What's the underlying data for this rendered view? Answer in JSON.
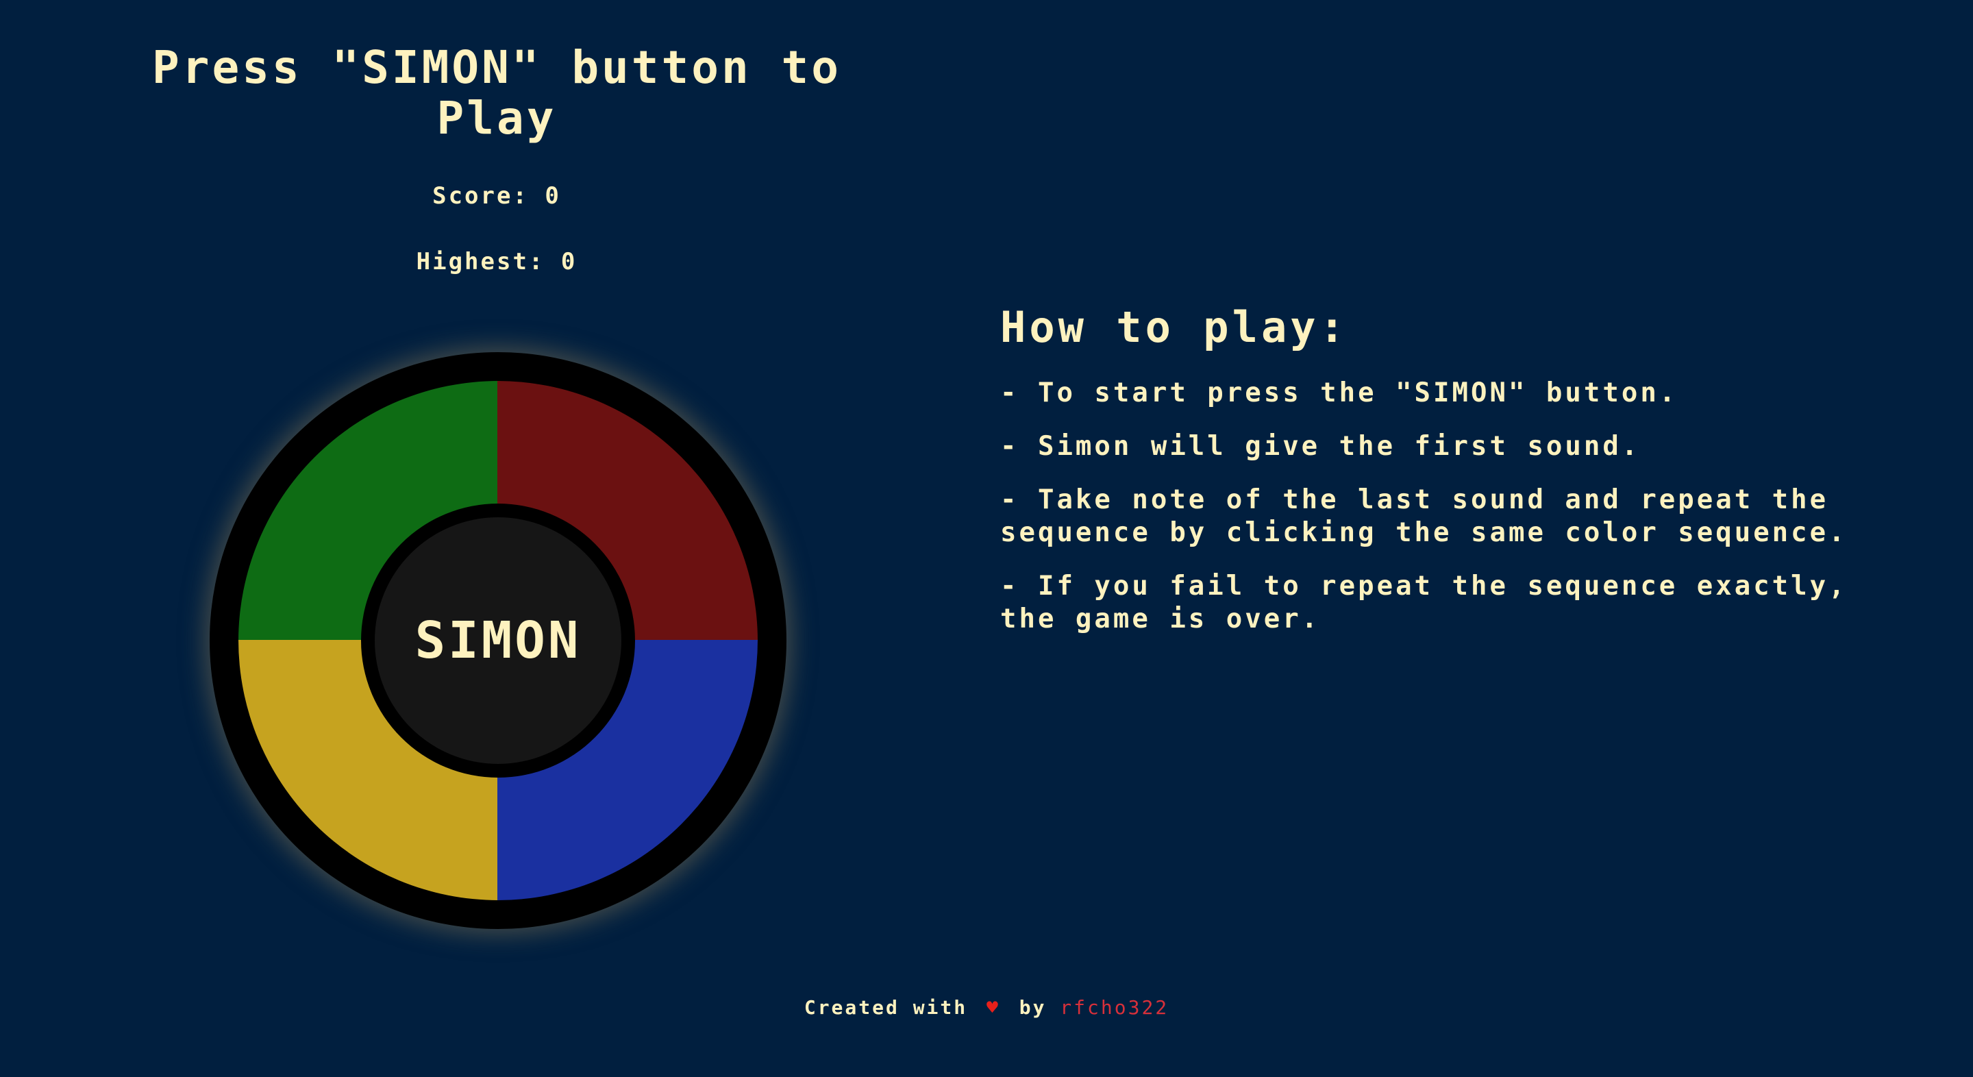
{
  "game": {
    "title": "Press \"SIMON\" button to Play",
    "score_label": "Score: 0",
    "highest_label": "Highest: 0",
    "center_button_label": "SIMON",
    "pads": [
      {
        "name": "green",
        "color": "#0e6c14"
      },
      {
        "name": "red",
        "color": "#6b1111"
      },
      {
        "name": "yellow",
        "color": "#c6a31f"
      },
      {
        "name": "blue",
        "color": "#1a30a0"
      }
    ]
  },
  "instructions": {
    "title": "How to play:",
    "rules": [
      "- To start press the \"SIMON\" button.",
      "- Simon will give the first sound.",
      "- Take note of the last sound and repeat the sequence by clicking the same color sequence.",
      "- If you fail to repeat the sequence exactly, the game is over."
    ]
  },
  "footer": {
    "prefix": "Created with",
    "icon": "heart-icon",
    "by": "by",
    "author": "rfcho322"
  },
  "colors": {
    "background": "#011f3f",
    "text": "#fef2bf",
    "heart": "#e8201b",
    "author_link": "#d8303a"
  }
}
